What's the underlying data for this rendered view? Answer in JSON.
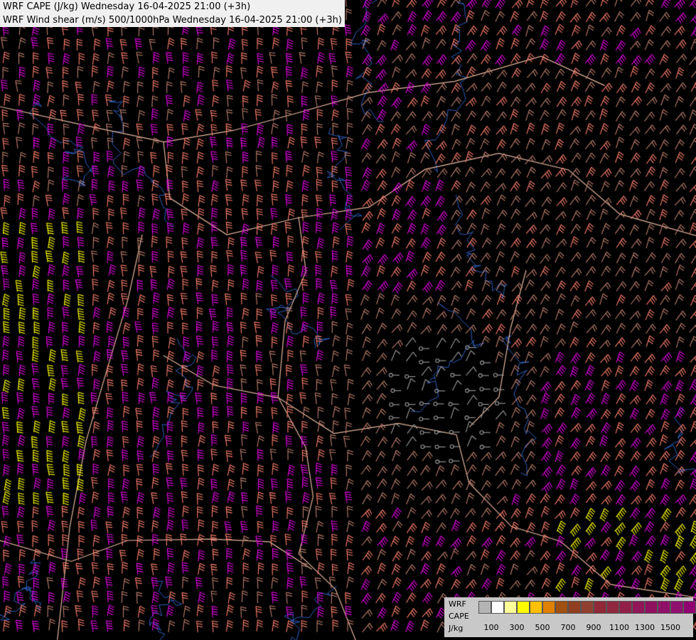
{
  "header": {
    "line1": "WRF CAPE (J/kg) Wednesday 16-04-2025 21:00 (+3h)",
    "line2": "WRF Wind shear (m/s) 500/1000hPa Wednesday 16-04-2025 21:00 (+3h)"
  },
  "legend": {
    "model_label": "WRF",
    "var_label": "CAPE",
    "unit_label": "J/kg",
    "swatches": [
      "#b4b4b4",
      "#ffffff",
      "#ffff99",
      "#ffff00",
      "#ffc000",
      "#e08000",
      "#a05010",
      "#904020",
      "#904030",
      "#902838",
      "#902840",
      "#902048",
      "#901858",
      "#901060",
      "#901068",
      "#901070",
      "#900070",
      "#880070"
    ],
    "ticks": [
      "100",
      "300",
      "500",
      "700",
      "900",
      "1100",
      "1300",
      "1500"
    ]
  },
  "map": {
    "background": "#000000",
    "border_color": "#e8b8a0",
    "river_color": "#3060c0",
    "shear_levels": [
      {
        "name": "calm",
        "color": "#a0a0a0"
      },
      {
        "name": "low",
        "color": "#c08070"
      },
      {
        "name": "moderate",
        "color": "#ff8070"
      },
      {
        "name": "strong",
        "color": "#e000e0"
      },
      {
        "name": "very-strong",
        "color": "#ffff00"
      }
    ]
  }
}
